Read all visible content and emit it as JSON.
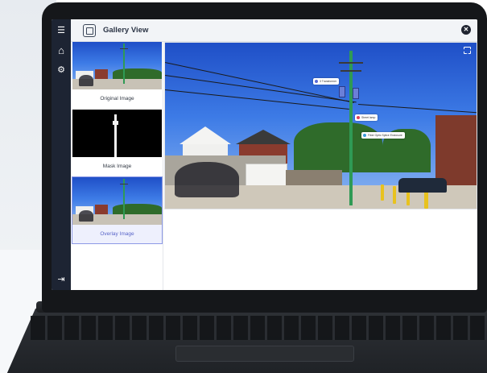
{
  "app": {
    "title": "Gallery View",
    "close_label": "✕"
  },
  "sidebar": {
    "items": [
      {
        "name": "menu",
        "glyph": "☰"
      },
      {
        "name": "home",
        "glyph": "⌂"
      },
      {
        "name": "settings",
        "glyph": "⚙"
      }
    ],
    "logout_glyph": "⇥"
  },
  "gallery": {
    "cards": [
      {
        "label": "Original Image",
        "selected": false
      },
      {
        "label": "Mask Image",
        "selected": false
      },
      {
        "label": "Overlay Image",
        "selected": true
      }
    ]
  },
  "viewer": {
    "tags": [
      {
        "label": "3 Transformer",
        "color": "#5a6bd6"
      },
      {
        "label": "Street lamp",
        "color": "#e0405a"
      },
      {
        "label": "Fiber Optic Splice Enclosure",
        "color": "#3a9bd9"
      }
    ]
  },
  "colors": {
    "sidebar": "#1d2433",
    "accent": "#8e9ae6",
    "pole": "#2f9a55"
  }
}
